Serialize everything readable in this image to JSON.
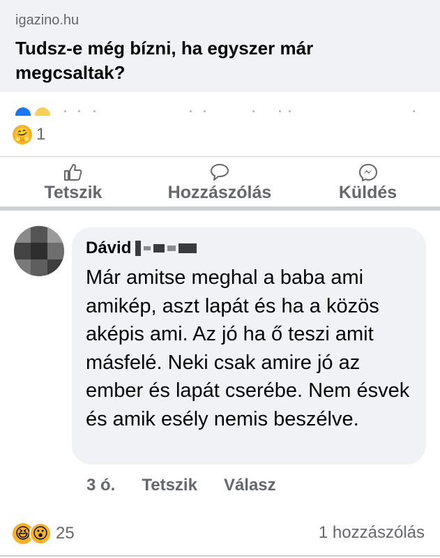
{
  "link_preview": {
    "domain": "igazino.hu",
    "title": "Tudsz-e még bízni, ha egyszer már megcsaltak?"
  },
  "post_reactions": {
    "count": "1",
    "emoji": "hug-emoji"
  },
  "actions": {
    "like": "Tetszik",
    "comment": "Hozzászólás",
    "share": "Küldés"
  },
  "comment": {
    "author": "Dávid",
    "text": "Már amitse meghal a baba ami amikép, aszt lapát és ha a közös aképis ami. Az jó ha ő teszi amit másfelé. Neki csak amire jó az ember és lapát cserébe. Nem ésvek és amik esély nemis beszélve.",
    "time": "3 ó.",
    "like_label": "Tetszik",
    "reply_label": "Válasz"
  },
  "footer": {
    "reactions_count": "25",
    "comments_count": "1 hozzászólás"
  },
  "colors": {
    "background": "#ffffff",
    "card": "#f0f2f5",
    "secondary_text": "#65676b",
    "divider": "#ced0d4"
  }
}
